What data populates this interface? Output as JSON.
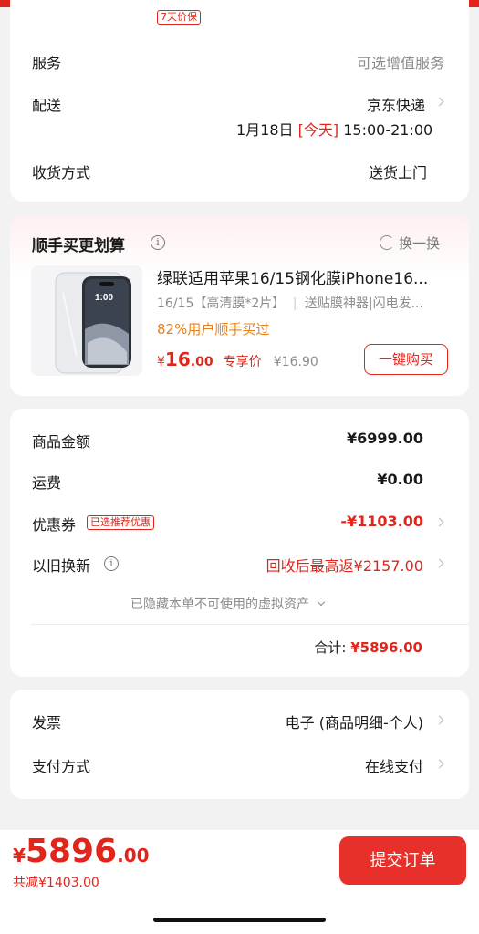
{
  "top_tag": "7天价保",
  "delivery": {
    "service_label": "服务",
    "service_value": "可选增值服务",
    "shipping_label": "配送",
    "shipping_value": "京东快递",
    "shipping_date": "1月18日",
    "shipping_today": "[今天]",
    "shipping_time": "15:00-21:00",
    "receive_label": "收货方式",
    "receive_value": "送货上门"
  },
  "addon": {
    "title": "顺手买更划算",
    "refresh_label": "换一换",
    "product_title": "绿联适用苹果16/15钢化膜iPhone16...",
    "product_subtitle": "16/15【高清膜*2片】",
    "product_subtitle2": "送贴膜神器|闪电发...",
    "product_note": "82%用户顺手买过",
    "price_currency": "¥",
    "price_int": "16",
    "price_dec": ".00",
    "price_tag": "专享价",
    "original_price": "¥16.90",
    "buy_label": "一键购买",
    "phone_time": "1:00"
  },
  "summary": {
    "amount_label": "商品金额",
    "amount_value": "¥6999.00",
    "shipping_label": "运费",
    "shipping_value": "¥0.00",
    "coupon_label": "优惠券",
    "coupon_tag": "已选推荐优惠",
    "coupon_value": "-¥1103.00",
    "tradein_label": "以旧换新",
    "tradein_value": "回收后最高返¥2157.00",
    "hidden_assets": "已隐藏本单不可使用的虚拟资产",
    "total_label": "合计:",
    "total_value": "¥5896.00"
  },
  "invoice": {
    "invoice_label": "发票",
    "invoice_value": "电子 (商品明细-个人)",
    "payment_label": "支付方式",
    "payment_value": "在线支付"
  },
  "bottom": {
    "currency": "¥",
    "price_int": "5896",
    "price_dec": ".00",
    "saved": "共减¥1403.00",
    "submit_label": "提交订单"
  },
  "colors": {
    "accent": "#e1251b",
    "note_orange": "#e8811c",
    "submit_bg": "#e8302b"
  }
}
